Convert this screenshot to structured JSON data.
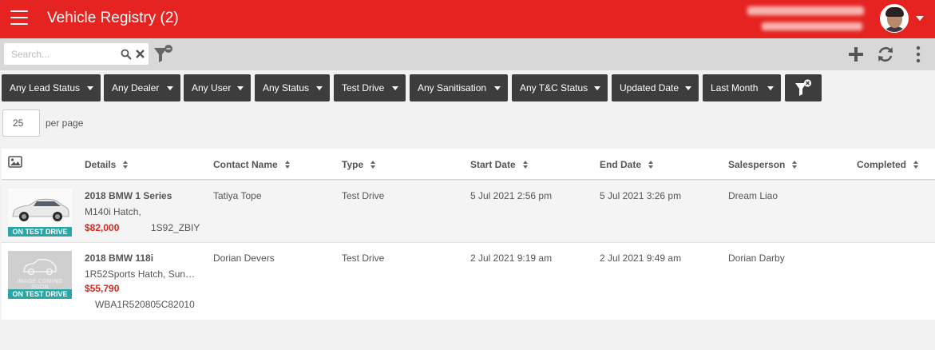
{
  "header": {
    "title": "Vehicle Registry (2)",
    "menu_icon": "hamburger-menu-icon",
    "user_avatar": "avatar",
    "brand_color": "#e52421"
  },
  "toolbar": {
    "search_placeholder": "Search...",
    "search_value": "",
    "icons": [
      "search-icon",
      "clear-icon",
      "filter-icon",
      "add-icon",
      "refresh-icon",
      "kebab-menu-icon"
    ]
  },
  "filters": [
    {
      "label": "Any Lead Status"
    },
    {
      "label": "Any Dealer"
    },
    {
      "label": "Any User"
    },
    {
      "label": "Any Status"
    },
    {
      "label": "Test Drive"
    },
    {
      "label": "Any Sanitisation"
    },
    {
      "label": "Any T&C Status"
    },
    {
      "label": "Updated Date"
    },
    {
      "label": "Last Month"
    }
  ],
  "pagination": {
    "per_page_value": "25",
    "per_page_label": "per page"
  },
  "table": {
    "columns": [
      "Details",
      "Contact Name",
      "Type",
      "Start Date",
      "End Date",
      "Salesperson",
      "Completed"
    ],
    "rows": [
      {
        "title": "2018 BMW 1 Series",
        "subtitle": "M140i Hatch,",
        "price": "$82,000",
        "code": "1S92_ZBIY",
        "badge": "ON TEST DRIVE",
        "contact": "Tatiya Tope",
        "type": "Test Drive",
        "start": "5 Jul 2021 2:56 pm",
        "end": "5 Jul 2021 3:26 pm",
        "salesperson": "Dream Liao",
        "completed": ""
      },
      {
        "title": "2018 BMW 118i",
        "subtitle": "1R52Sports Hatch, Sun…",
        "price": "$55,790",
        "code": "WBA1R520805C82010",
        "badge": "ON TEST DRIVE",
        "image_placeholder": "IMAGE COMING SOON",
        "contact": "Dorian Devers",
        "type": "Test Drive",
        "start": "2 Jul 2021 9:19 am",
        "end": "2 Jul 2021 9:49 am",
        "salesperson": "Dorian Darby",
        "completed": ""
      }
    ]
  },
  "colors": {
    "accent": "#e52421",
    "chip_bg": "#3d3d3d",
    "badge": "#2aa6a6",
    "price": "#d9251d"
  }
}
